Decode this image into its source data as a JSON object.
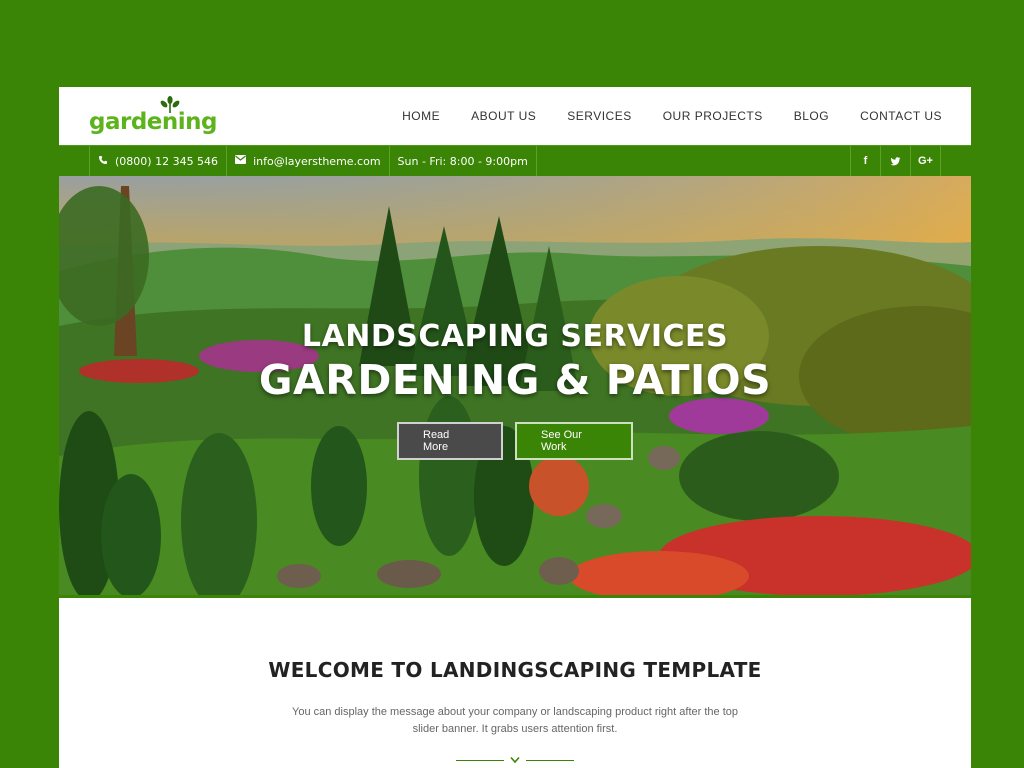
{
  "brand": {
    "logo_text": "gardening",
    "accent": "#3a8505",
    "logo_color": "#5cb31b"
  },
  "nav": {
    "items": [
      {
        "label": "HOME"
      },
      {
        "label": "ABOUT US"
      },
      {
        "label": "SERVICES"
      },
      {
        "label": "OUR PROJECTS"
      },
      {
        "label": "BLOG"
      },
      {
        "label": "CONTACT US"
      }
    ]
  },
  "topbar": {
    "phone": {
      "icon": "phone-icon",
      "text": "(0800) 12 345 546"
    },
    "email": {
      "icon": "envelope-icon",
      "text": "info@layerstheme.com"
    },
    "hours": "Sun - Fri: 8:00 - 9:00pm",
    "social": [
      {
        "icon": "facebook-icon",
        "glyph": "f"
      },
      {
        "icon": "twitter-icon",
        "glyph": "t"
      },
      {
        "icon": "google-plus-icon",
        "glyph": "G+"
      }
    ]
  },
  "hero": {
    "subtitle": "LANDSCAPING SERVICES",
    "title": "GARDENING & PATIOS",
    "buttons": {
      "read_more": "Read More",
      "see_work": "See Our Work"
    }
  },
  "welcome": {
    "heading": "WELCOME TO LANDINGSCAPING TEMPLATE",
    "text": "You can display the message about your company or landscaping product right after the top slider banner. It grabs users attention first."
  }
}
